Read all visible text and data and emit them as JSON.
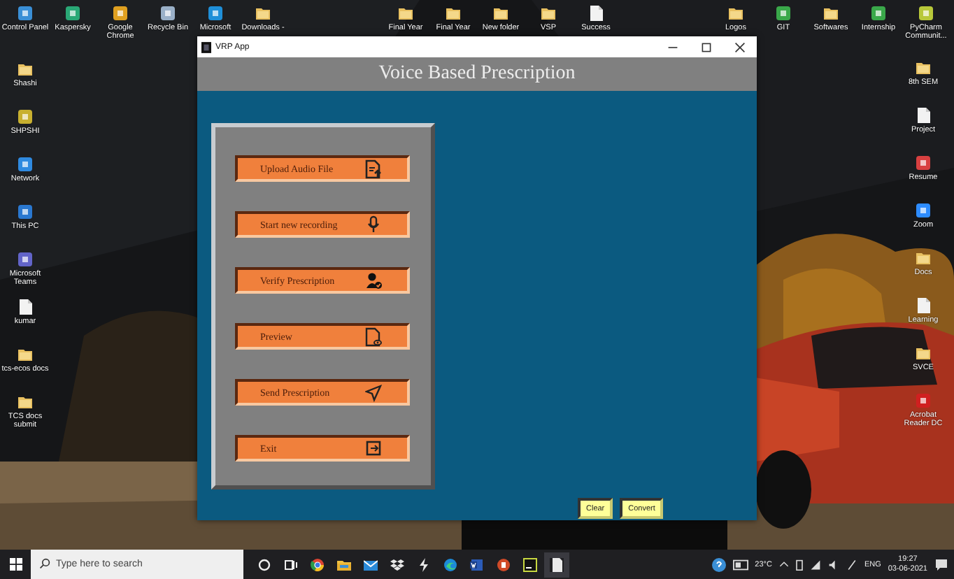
{
  "desktop": {
    "top_row_left": [
      {
        "label": "Control Panel",
        "kind": "app",
        "color": "#3a8fd6"
      },
      {
        "label": "Kaspersky",
        "kind": "app",
        "color": "#2aa876"
      },
      {
        "label": "Google Chrome",
        "kind": "app",
        "color": "#e0a020"
      },
      {
        "label": "Recycle Bin",
        "kind": "app",
        "color": "#9ab0c8"
      },
      {
        "label": "Microsoft",
        "kind": "app",
        "color": "#1f8fd8"
      },
      {
        "label": "Downloads -",
        "kind": "folder"
      }
    ],
    "top_row_center": [
      {
        "label": "Final Year",
        "kind": "folder"
      },
      {
        "label": "Final Year",
        "kind": "folder"
      },
      {
        "label": "New folder",
        "kind": "folder"
      },
      {
        "label": "VSP",
        "kind": "folder"
      },
      {
        "label": "Success",
        "kind": "file"
      }
    ],
    "top_row_right": [
      {
        "label": "Logos",
        "kind": "folder"
      },
      {
        "label": "GIT",
        "kind": "app",
        "color": "#3aa84a"
      },
      {
        "label": "Softwares",
        "kind": "folder"
      },
      {
        "label": "Internship",
        "kind": "app",
        "color": "#3aa84a"
      },
      {
        "label": "PyCharm Communit...",
        "kind": "app",
        "color": "#b8c83a"
      }
    ],
    "left_column": [
      {
        "label": "Shashi",
        "kind": "folder"
      },
      {
        "label": "SHPSHI",
        "kind": "app",
        "color": "#c8b030"
      },
      {
        "label": "Network",
        "kind": "app",
        "color": "#2f8ae0"
      },
      {
        "label": "This PC",
        "kind": "app",
        "color": "#2a78d0"
      },
      {
        "label": "Microsoft Teams",
        "kind": "app",
        "color": "#6264c8"
      },
      {
        "label": "kumar",
        "kind": "file"
      },
      {
        "label": "tcs-ecos docs",
        "kind": "folder"
      },
      {
        "label": "TCS docs submit",
        "kind": "folder"
      }
    ],
    "right_column": [
      {
        "label": "8th SEM",
        "kind": "folder"
      },
      {
        "label": "Project",
        "kind": "file"
      },
      {
        "label": "Resume",
        "kind": "app",
        "color": "#d84040"
      },
      {
        "label": "Zoom",
        "kind": "app",
        "color": "#2d8cff"
      },
      {
        "label": "Docs",
        "kind": "folder"
      },
      {
        "label": "Learning",
        "kind": "file"
      },
      {
        "label": "SVCE",
        "kind": "folder"
      },
      {
        "label": "Acrobat Reader DC",
        "kind": "app",
        "color": "#d02020"
      }
    ]
  },
  "window": {
    "title": "VRP App",
    "heading": "Voice Based Prescription",
    "menu_buttons": [
      {
        "label": "Upload Audio File"
      },
      {
        "label": "Start new recording"
      },
      {
        "label": "Verify Prescription"
      },
      {
        "label": "Preview"
      },
      {
        "label": "Send Prescription"
      },
      {
        "label": "Exit"
      }
    ],
    "action_buttons": [
      "Clear",
      "Convert"
    ]
  },
  "taskbar": {
    "search": {
      "placeholder": "Type here to search"
    },
    "temperature": "23°C",
    "language": "ENG",
    "time": "19:27",
    "date": "03-06-2021"
  }
}
